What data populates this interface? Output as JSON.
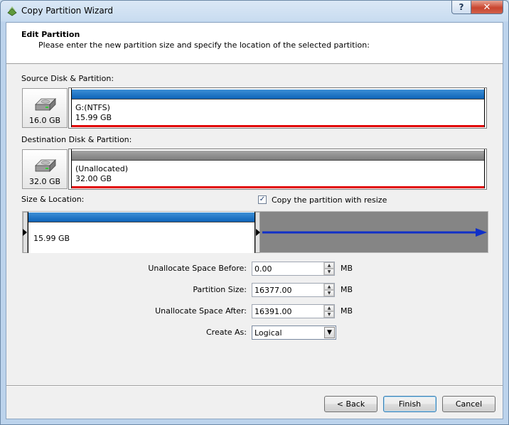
{
  "window": {
    "title": "Copy Partition Wizard",
    "help_label": "?",
    "close_label": "✕"
  },
  "header": {
    "title": "Edit Partition",
    "subtitle": "Please enter the new partition size and specify the location of the selected partition:"
  },
  "source": {
    "label": "Source Disk & Partition:",
    "disk_size": "16.0 GB",
    "partition_name": "G:(NTFS)",
    "partition_size": "15.99 GB"
  },
  "destination": {
    "label": "Destination Disk & Partition:",
    "disk_size": "32.0 GB",
    "partition_name": "(Unallocated)",
    "partition_size": "32.00 GB"
  },
  "size_location": {
    "label": "Size & Location:",
    "resize_checkbox_label": "Copy the partition with resize",
    "resize_checked": true,
    "check_glyph": "✓",
    "partition_size_text": "15.99 GB",
    "partition_fraction": 0.494
  },
  "fields": {
    "before": {
      "label": "Unallocate Space Before:",
      "value": "0.00",
      "unit": "MB"
    },
    "size": {
      "label": "Partition Size:",
      "value": "16377.00",
      "unit": "MB"
    },
    "after": {
      "label": "Unallocate Space After:",
      "value": "16391.00",
      "unit": "MB"
    },
    "create_as": {
      "label": "Create As:",
      "value": "Logical"
    }
  },
  "glyphs": {
    "spin_up": "▲",
    "spin_down": "▼",
    "combo_arrow": "▼"
  },
  "buttons": {
    "back": "< Back",
    "finish": "Finish",
    "cancel": "Cancel"
  },
  "colors": {
    "partition_blue": "#0e63b8",
    "unallocated_gray": "#858585",
    "used_red": "#e00000",
    "arrow_blue": "#1030c8"
  },
  "icons": {
    "app": "wizard-app-icon",
    "drive": "hard-drive-icon",
    "arrow": "right-arrow-icon"
  }
}
